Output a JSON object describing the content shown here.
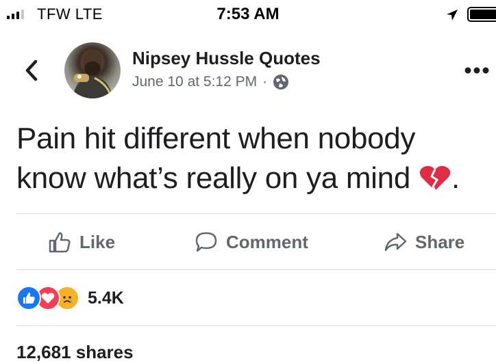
{
  "status_bar": {
    "carrier": "TFW  LTE",
    "time": "7:53 AM",
    "signal_bars": 3,
    "battery_level": 1.0
  },
  "post": {
    "page_name": "Nipsey Hussle Quotes",
    "date": "June 10 at 5:12 PM",
    "separator": "·",
    "privacy_icon": "globe-icon",
    "text_line1": "Pain hit different when nobody",
    "text_line2": "know what’s really on ya mind",
    "text_suffix": ".",
    "emoji": "broken-heart-icon"
  },
  "actions": {
    "like_label": "Like",
    "comment_label": "Comment",
    "share_label": "Share"
  },
  "engagement": {
    "reactions": [
      "like-reaction-icon",
      "love-reaction-icon",
      "sad-reaction-icon"
    ],
    "reaction_count": "5.4K",
    "shares": "12,681 shares"
  },
  "colors": {
    "primary_text": "#1c1e21",
    "secondary_text": "#606770",
    "like_blue": "#1877f2",
    "love_red": "#f33e58",
    "sad_yellow": "#f7b125",
    "heart_red": "#dd2e44",
    "divider": "#dadde1"
  }
}
